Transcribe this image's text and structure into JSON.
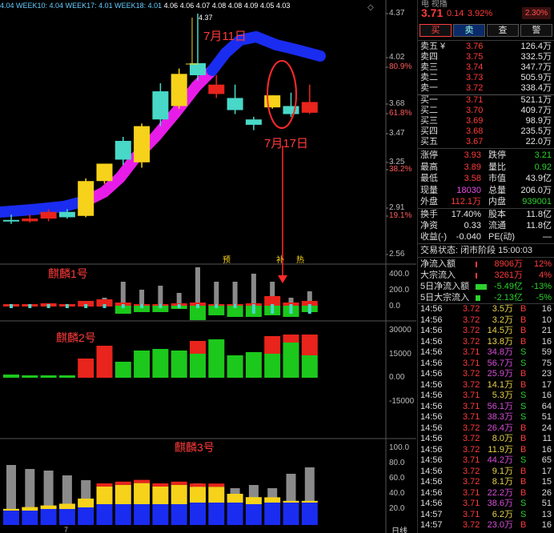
{
  "header": {
    "ma_legend": [
      "4.04",
      "WEEK10: 4.04",
      "WEEK17: 4.01",
      "WEEK18: 4.01",
      "4.06",
      "4.06",
      "4.07",
      "4.08",
      "4.08",
      "4.09",
      "4.05",
      "4.03"
    ],
    "price": "3.71",
    "change": "0.14",
    "change_pct": "3.92%",
    "badge": "2.30%",
    "top_text": "电 视播"
  },
  "buttons": [
    "买",
    "卖",
    "查",
    "警"
  ],
  "price_axis": [
    "4.37",
    "4.02",
    "80.9%",
    "3.68",
    "61.8%",
    "3.47",
    "3.25",
    "38.2%",
    "2.91",
    "19.1%",
    "2.56"
  ],
  "annotations": {
    "high_label": "4.37",
    "date1": "7月11日",
    "date2": "7月17日",
    "markers": [
      "预",
      "补",
      "热"
    ]
  },
  "panels": {
    "p1": {
      "title": "麒麟1号",
      "ticks": [
        "400.0",
        "200.0",
        "0.0"
      ]
    },
    "p2": {
      "title": "麒麟2号",
      "ticks": [
        "30000",
        "15000",
        "0.00",
        "-15000"
      ]
    },
    "p3": {
      "title": "麒麟3号",
      "ticks": [
        "100.0",
        "80.0",
        "60.0",
        "40.0",
        "20.0"
      ]
    },
    "x_label": "7",
    "corner": "日线"
  },
  "order_book": {
    "asks": [
      {
        "label": "卖五 ¥",
        "price": "3.76",
        "vol": "126.4万"
      },
      {
        "label": "卖四",
        "price": "3.75",
        "vol": "332.5万"
      },
      {
        "label": "卖三",
        "price": "3.74",
        "vol": "347.7万"
      },
      {
        "label": "卖二",
        "price": "3.73",
        "vol": "505.9万"
      },
      {
        "label": "卖一",
        "price": "3.72",
        "vol": "338.4万"
      }
    ],
    "bids": [
      {
        "label": "买一",
        "price": "3.71",
        "vol": "521.1万"
      },
      {
        "label": "买二",
        "price": "3.70",
        "vol": "409.7万"
      },
      {
        "label": "买三",
        "price": "3.69",
        "vol": "98.9万"
      },
      {
        "label": "买四",
        "price": "3.68",
        "vol": "235.5万"
      },
      {
        "label": "买五",
        "price": "3.67",
        "vol": "22.0万"
      }
    ]
  },
  "stats": [
    {
      "l1": "涨停",
      "v1": "3.93",
      "l2": "跌停",
      "v2": "3.21",
      "c1": "red",
      "c2": "green"
    },
    {
      "l1": "最高",
      "v1": "3.89",
      "l2": "量比",
      "v2": "0.92",
      "c1": "red",
      "c2": "green"
    },
    {
      "l1": "最低",
      "v1": "3.58",
      "l2": "市值",
      "v2": "43.9亿",
      "c1": "red",
      "c2": "white"
    },
    {
      "l1": "现量",
      "v1": "18030",
      "l2": "总量",
      "v2": "206.0万",
      "c1": "magenta",
      "c2": "white"
    },
    {
      "l1": "外盘",
      "v1": "112.1万",
      "l2": "内盘",
      "v2": "939001",
      "c1": "red",
      "c2": "green"
    }
  ],
  "stats2": [
    {
      "l1": "换手",
      "v1": "17.40%",
      "l2": "股本",
      "v2": "11.8亿"
    },
    {
      "l1": "净资",
      "v1": "0.33",
      "l2": "流通",
      "v2": "11.8亿"
    },
    {
      "l1": "收益(-)",
      "v1": "-0.040",
      "l2": "PE(动)",
      "v2": "—"
    }
  ],
  "trade_status": "交易状态: 闭市阶段 15:00:03",
  "flows": [
    {
      "label": "净流入额",
      "value": "8906万",
      "pct": "12%",
      "color": "red",
      "bar": 0.06
    },
    {
      "label": "大宗流入",
      "value": "3261万",
      "pct": "4%",
      "color": "red",
      "bar": 0.03
    },
    {
      "label": "5日净流入额",
      "value": "-5.49亿",
      "pct": "-13%",
      "color": "green",
      "bar": 0.9
    },
    {
      "label": "5日大宗流入",
      "value": "-2.13亿",
      "pct": "-5%",
      "color": "green",
      "bar": 0.4
    }
  ],
  "ticks": [
    {
      "t": "14:56",
      "p": "3.72",
      "v": "3.5万",
      "s": "B",
      "n": "16",
      "vc": "yellow"
    },
    {
      "t": "14:56",
      "p": "3.72",
      "v": "3.2万",
      "s": "B",
      "n": "10",
      "vc": "yellow"
    },
    {
      "t": "14:56",
      "p": "3.72",
      "v": "14.5万",
      "s": "B",
      "n": "21",
      "vc": "yellow"
    },
    {
      "t": "14:56",
      "p": "3.72",
      "v": "13.8万",
      "s": "B",
      "n": "16",
      "vc": "yellow"
    },
    {
      "t": "14:56",
      "p": "3.71",
      "v": "34.8万",
      "s": "S",
      "n": "59",
      "vc": "magenta"
    },
    {
      "t": "14:56",
      "p": "3.71",
      "v": "56.7万",
      "s": "S",
      "n": "75",
      "vc": "magenta"
    },
    {
      "t": "14:56",
      "p": "3.72",
      "v": "25.9万",
      "s": "B",
      "n": "23",
      "vc": "magenta"
    },
    {
      "t": "14:56",
      "p": "3.72",
      "v": "14.1万",
      "s": "B",
      "n": "17",
      "vc": "yellow"
    },
    {
      "t": "14:56",
      "p": "3.71",
      "v": "5.3万",
      "s": "S",
      "n": "16",
      "vc": "yellow"
    },
    {
      "t": "14:56",
      "p": "3.71",
      "v": "56.1万",
      "s": "S",
      "n": "64",
      "vc": "magenta"
    },
    {
      "t": "14:56",
      "p": "3.71",
      "v": "38.3万",
      "s": "S",
      "n": "51",
      "vc": "magenta"
    },
    {
      "t": "14:56",
      "p": "3.72",
      "v": "26.4万",
      "s": "B",
      "n": "24",
      "vc": "magenta"
    },
    {
      "t": "14:56",
      "p": "3.72",
      "v": "8.0万",
      "s": "B",
      "n": "11",
      "vc": "yellow"
    },
    {
      "t": "14:56",
      "p": "3.72",
      "v": "11.9万",
      "s": "B",
      "n": "16",
      "vc": "yellow"
    },
    {
      "t": "14:56",
      "p": "3.71",
      "v": "44.2万",
      "s": "S",
      "n": "65",
      "vc": "magenta"
    },
    {
      "t": "14:56",
      "p": "3.72",
      "v": "9.1万",
      "s": "B",
      "n": "17",
      "vc": "yellow"
    },
    {
      "t": "14:56",
      "p": "3.72",
      "v": "8.1万",
      "s": "B",
      "n": "15",
      "vc": "yellow"
    },
    {
      "t": "14:56",
      "p": "3.71",
      "v": "22.2万",
      "s": "B",
      "n": "26",
      "vc": "magenta"
    },
    {
      "t": "14:56",
      "p": "3.71",
      "v": "38.6万",
      "s": "S",
      "n": "51",
      "vc": "magenta"
    },
    {
      "t": "14:57",
      "p": "3.71",
      "v": "6.2万",
      "s": "S",
      "n": "13",
      "vc": "yellow"
    },
    {
      "t": "14:57",
      "p": "3.72",
      "v": "23.0万",
      "s": "B",
      "n": "16",
      "vc": "magenta"
    }
  ],
  "candles": [
    {
      "o": 2.83,
      "c": 2.83,
      "h": 2.87,
      "l": 2.8,
      "color": "cyan"
    },
    {
      "o": 2.82,
      "c": 2.84,
      "h": 2.87,
      "l": 2.81,
      "color": "red"
    },
    {
      "o": 2.84,
      "c": 2.89,
      "h": 2.91,
      "l": 2.82,
      "color": "red"
    },
    {
      "o": 2.89,
      "c": 2.85,
      "h": 2.91,
      "l": 2.84,
      "color": "cyan"
    },
    {
      "o": 2.86,
      "c": 3.12,
      "h": 3.14,
      "l": 2.85,
      "color": "yellow"
    },
    {
      "o": 3.12,
      "c": 3.25,
      "h": 3.25,
      "l": 3.1,
      "color": "yellow"
    },
    {
      "o": 3.42,
      "c": 3.28,
      "h": 3.45,
      "l": 3.24,
      "color": "cyan"
    },
    {
      "o": 3.26,
      "c": 3.53,
      "h": 3.55,
      "l": 3.22,
      "color": "yellow"
    },
    {
      "o": 3.58,
      "c": 3.79,
      "h": 3.85,
      "l": 3.53,
      "color": "cyan"
    },
    {
      "o": 3.68,
      "c": 3.92,
      "h": 3.96,
      "l": 3.66,
      "color": "yellow"
    },
    {
      "o": 3.91,
      "c": 4.0,
      "h": 4.37,
      "l": 3.87,
      "color": "cyan"
    },
    {
      "o": 3.84,
      "c": 3.77,
      "h": 3.91,
      "l": 3.74,
      "color": "red"
    },
    {
      "o": 3.74,
      "c": 3.65,
      "h": 3.84,
      "l": 3.62,
      "color": "cyan"
    },
    {
      "o": 3.58,
      "c": 3.54,
      "h": 3.6,
      "l": 3.5,
      "color": "cyan"
    },
    {
      "o": 3.67,
      "c": 3.76,
      "h": 3.76,
      "l": 3.66,
      "color": "yellow"
    },
    {
      "o": 3.62,
      "c": 3.68,
      "h": 3.78,
      "l": 3.6,
      "color": "cyan"
    },
    {
      "o": 3.63,
      "c": 3.71,
      "h": 3.84,
      "l": 3.62,
      "color": "red"
    }
  ],
  "colors": {
    "red": "#e8241c",
    "green": "#1cc81c",
    "yellow": "#f7d21a",
    "cyan": "#48d8c8",
    "blue": "#1a2cf0",
    "magenta": "#e81ce8",
    "gray": "#8a8a8a"
  }
}
